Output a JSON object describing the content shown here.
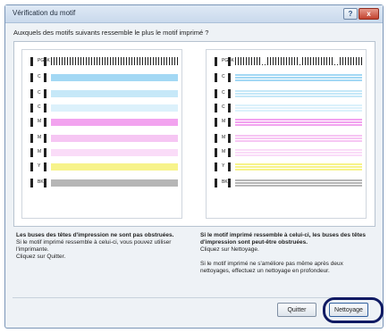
{
  "window": {
    "title": "Vérification du motif",
    "help_glyph": "?",
    "close_glyph": "x"
  },
  "question": "Auxquels des motifs suivants ressemble le plus le motif imprimé ?",
  "patterns": {
    "left": {
      "rows": [
        {
          "label": "PGBK",
          "color": "nozzle"
        },
        {
          "label": "C",
          "color": "#a3d8f4"
        },
        {
          "label": "C",
          "color": "#c6e8f8"
        },
        {
          "label": "C",
          "color": "#dcf1fb"
        },
        {
          "label": "M",
          "color": "#f2a3ef"
        },
        {
          "label": "M",
          "color": "#f6c6f3"
        },
        {
          "label": "M",
          "color": "#fadcf8"
        },
        {
          "label": "Y",
          "color": "#f7f38a"
        },
        {
          "label": "BK",
          "color": "#b6b6b6"
        }
      ]
    },
    "right": {
      "rows": [
        {
          "label": "PGBK",
          "color": "nozzle"
        },
        {
          "label": "C",
          "color": "#a3d8f4"
        },
        {
          "label": "C",
          "color": "#c6e8f8"
        },
        {
          "label": "C",
          "color": "#dcf1fb"
        },
        {
          "label": "M",
          "color": "#f2a3ef"
        },
        {
          "label": "M",
          "color": "#f6c6f3"
        },
        {
          "label": "M",
          "color": "#fadcf8"
        },
        {
          "label": "Y",
          "color": "#f7f38a"
        },
        {
          "label": "BK",
          "color": "#b6b6b6"
        }
      ]
    }
  },
  "left_description": {
    "bold": "Les buses des têtes d'impression ne sont pas obstruées.",
    "line1": "Si le motif imprimé ressemble à celui-ci, vous pouvez utiliser l'imprimante.",
    "line2": "Cliquez sur Quitter."
  },
  "right_description": {
    "bold": "Si le motif imprimé ressemble à celui-ci, les buses des têtes d'impression sont peut-être obstruées.",
    "line1": "Cliquez sur Nettoyage.",
    "line2": "Si le motif imprimé ne s'améliore pas même après deux nettoyages, effectuez un nettoyage en profondeur."
  },
  "buttons": {
    "quit_label": "Quitter",
    "clean_label": "Nettoyage"
  }
}
